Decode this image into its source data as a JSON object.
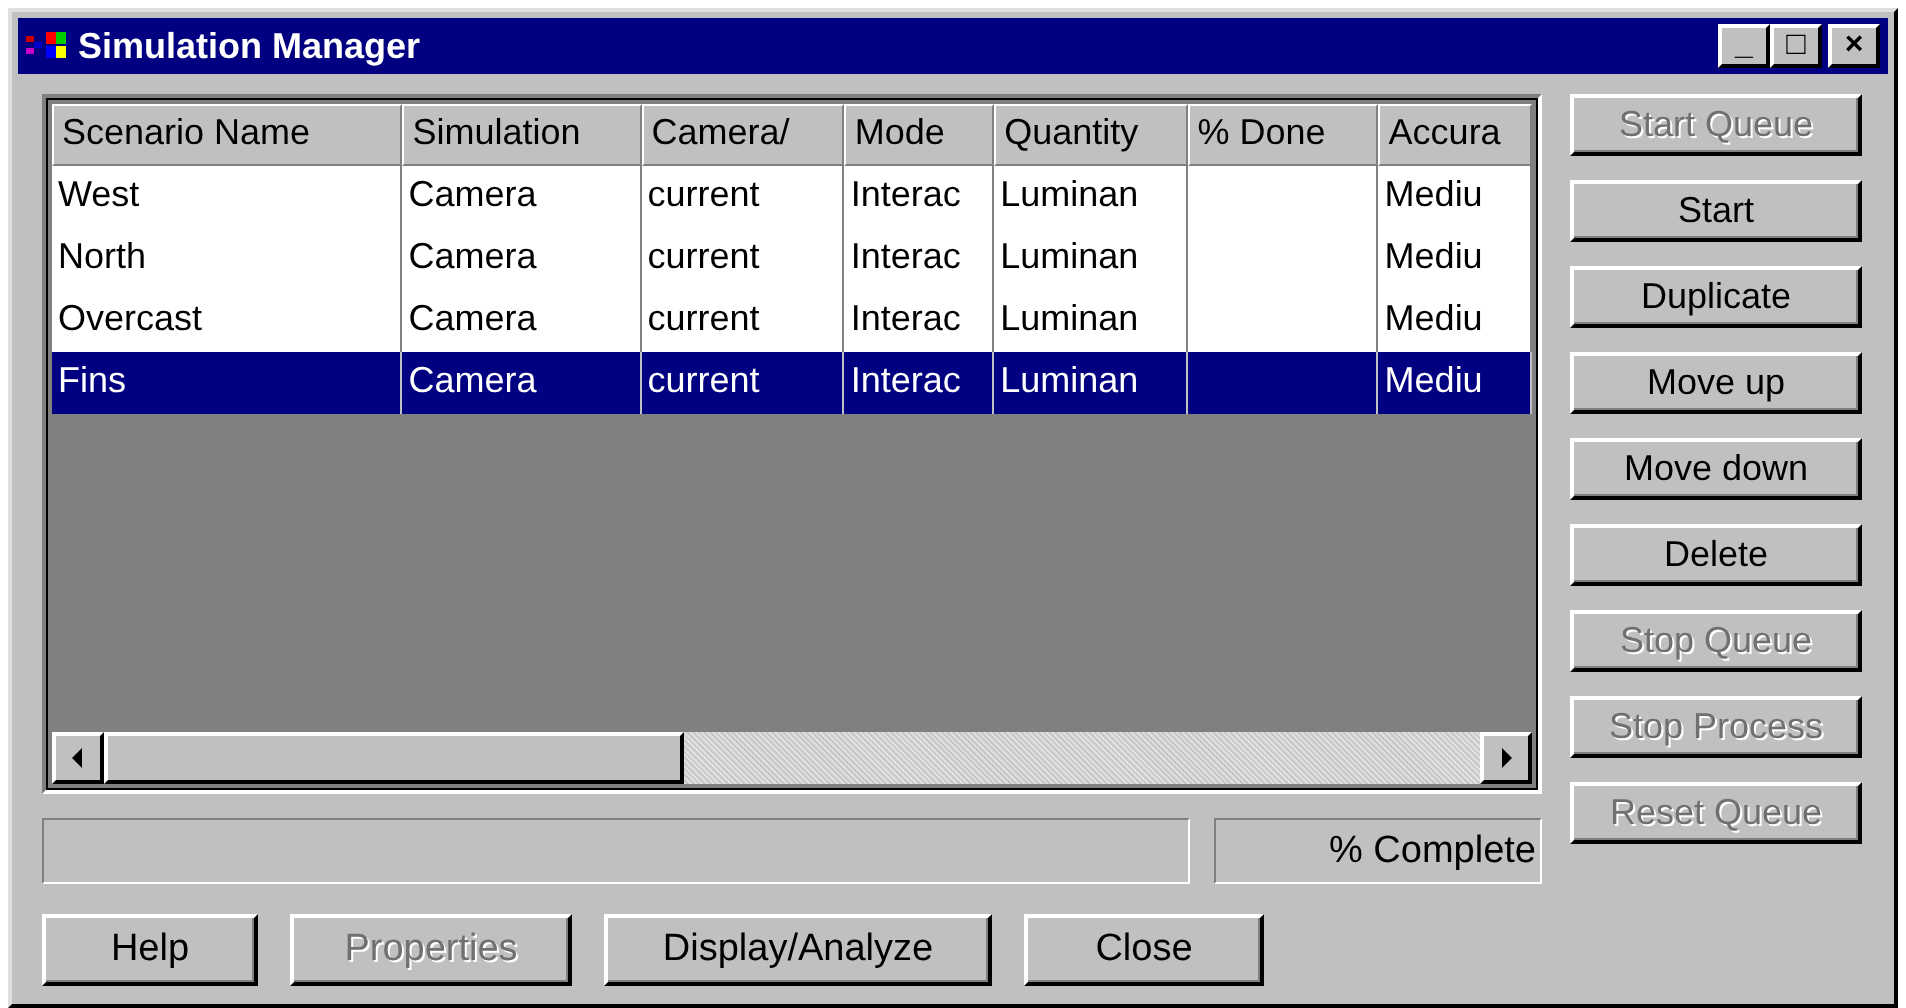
{
  "window": {
    "title": "Simulation Manager",
    "controls": [
      "_",
      "□",
      "×"
    ]
  },
  "table": {
    "columns": [
      "Scenario Name",
      "Simulation",
      "Camera/",
      "Mode",
      "Quantity",
      "% Done",
      "Accura"
    ],
    "rows": [
      {
        "cells": [
          "West",
          "Camera",
          "current",
          "Interac",
          "Luminan",
          "",
          "Mediu"
        ],
        "selected": false
      },
      {
        "cells": [
          "North",
          "Camera",
          "current",
          "Interac",
          "Luminan",
          "",
          "Mediu"
        ],
        "selected": false
      },
      {
        "cells": [
          "Overcast",
          "Camera",
          "current",
          "Interac",
          "Luminan",
          "",
          "Mediu"
        ],
        "selected": false
      },
      {
        "cells": [
          "Fins",
          "Camera",
          "current",
          "Interac",
          "Luminan",
          "",
          "Mediu"
        ],
        "selected": true
      }
    ]
  },
  "side_buttons": [
    {
      "label": "Start Queue",
      "disabled": true
    },
    {
      "label": "Start",
      "disabled": false
    },
    {
      "label": "Duplicate",
      "disabled": false
    },
    {
      "label": "Move up",
      "disabled": false
    },
    {
      "label": "Move down",
      "disabled": false
    },
    {
      "label": "Delete",
      "disabled": false
    },
    {
      "label": "Stop Queue",
      "disabled": true
    },
    {
      "label": "Stop Process",
      "disabled": true
    },
    {
      "label": "Reset Queue",
      "disabled": true
    }
  ],
  "status": {
    "progress_label": "% Complete"
  },
  "bottom_buttons": [
    {
      "label": "Help",
      "disabled": false
    },
    {
      "label": "Properties",
      "disabled": true
    },
    {
      "label": "Display/Analyze",
      "disabled": false
    },
    {
      "label": "Close",
      "disabled": false
    }
  ]
}
